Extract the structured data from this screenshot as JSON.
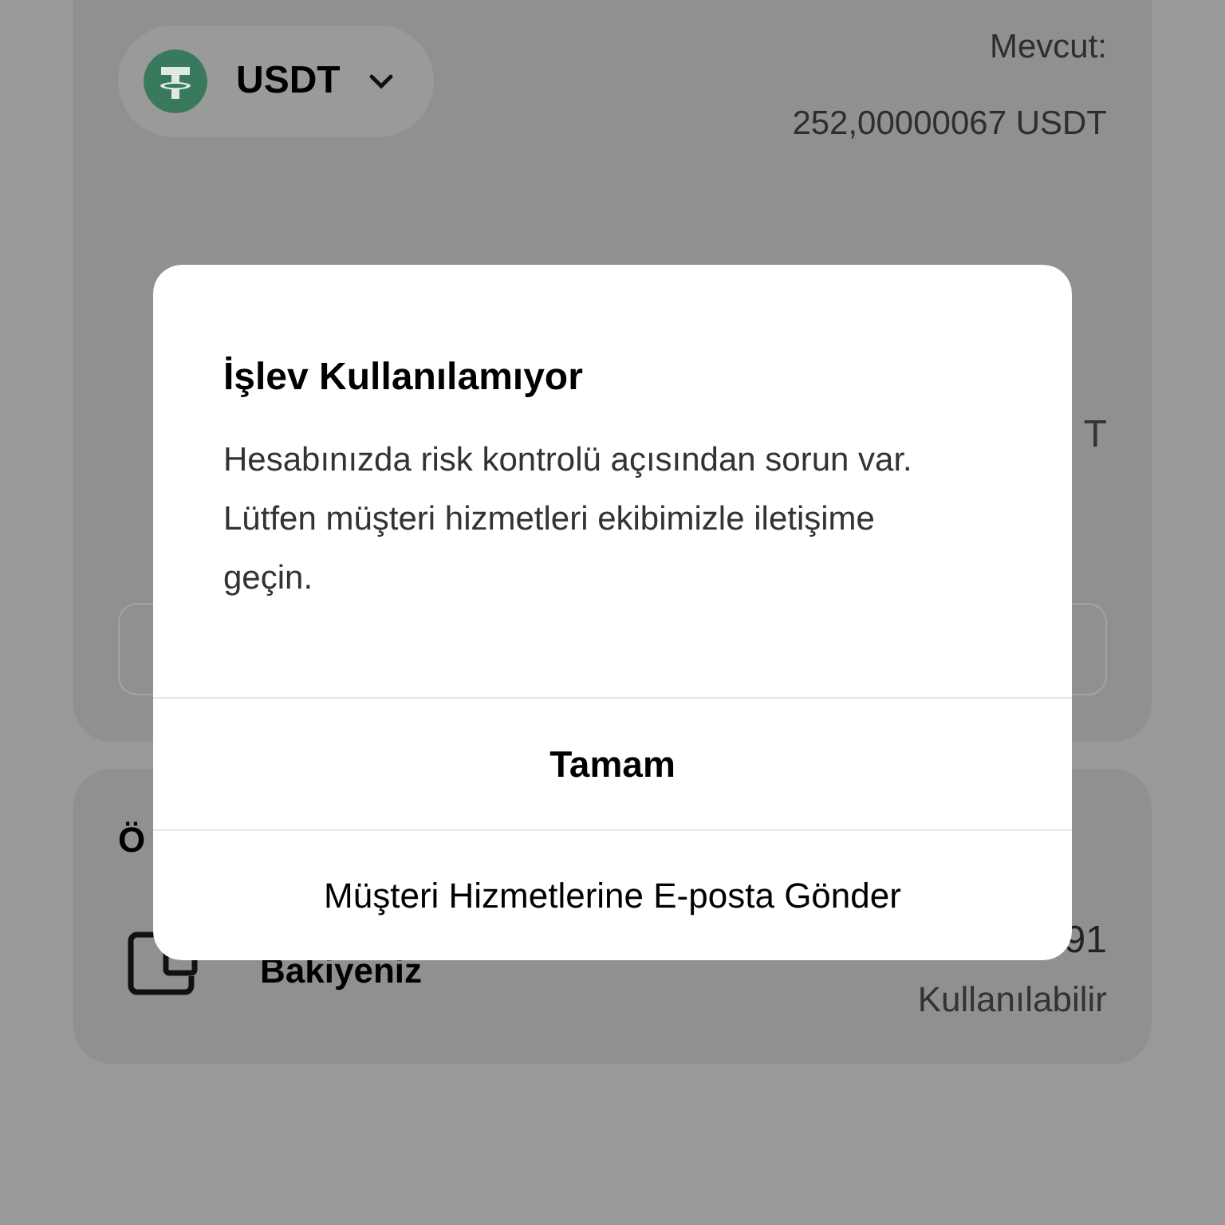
{
  "wallet_card": {
    "currency": "USDT",
    "available_label": "Mevcut:",
    "available_amount": "252,00000067 USDT",
    "converted_partial": "T"
  },
  "balance_card": {
    "title_partial": "Ö",
    "row_label": "Bakiyeniz",
    "row_value_partial": "91",
    "row_note": "Kullanılabilir"
  },
  "dialog": {
    "title": "İşlev Kullanılamıyor",
    "message": "Hesabınızda risk kontrolü açısından sorun var. Lütfen müşteri hizmetleri ekibimizle iletişime geçin.",
    "buttons": [
      {
        "label": "Tamam",
        "kind": "primary"
      },
      {
        "label": "Müşteri Hizmetlerine E-posta Gönder",
        "kind": "secondary"
      }
    ]
  }
}
